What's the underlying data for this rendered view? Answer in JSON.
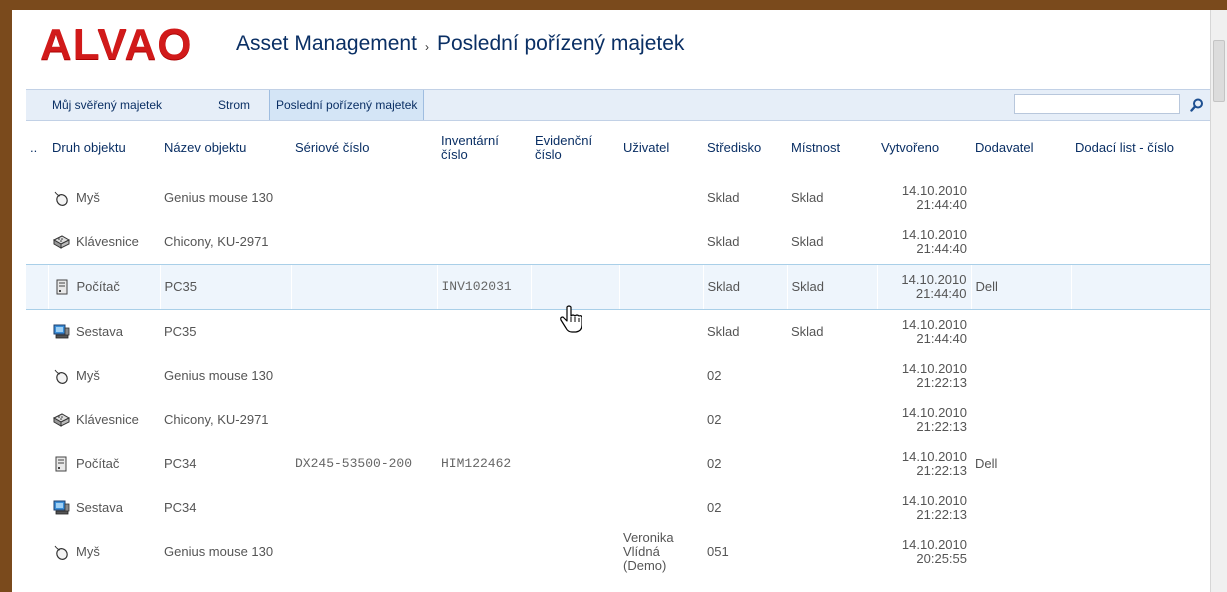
{
  "app": {
    "logo": "ALVAO",
    "breadcrumb": [
      "Asset Management",
      "Poslední pořízený majetek"
    ],
    "separator": "›"
  },
  "tabs": [
    {
      "label": "Můj svěřený majetek",
      "active": false
    },
    {
      "label": "Strom",
      "active": false
    },
    {
      "label": "Poslední pořízený majetek",
      "active": true
    }
  ],
  "search": {
    "value": "",
    "placeholder": ""
  },
  "table": {
    "columns": [
      "..",
      "Druh objektu",
      "Název objektu",
      "Sériové číslo",
      "Inventární číslo",
      "Evidenční číslo",
      "Uživatel",
      "Středisko",
      "Místnost",
      "Vytvořeno",
      "Dodavatel",
      "Dodací list - číslo"
    ],
    "rows": [
      {
        "icon": "mouse-icon",
        "druh": "Myš",
        "nazev": "Genius mouse 130",
        "seriove": "",
        "inventarni": "",
        "evidencni": "",
        "uzivatel": "",
        "stredisko": "Sklad",
        "mistnost": "Sklad",
        "vytvoreno_date": "14.10.2010",
        "vytvoreno_time": "21:44:40",
        "dodavatel": "",
        "dodaci": ""
      },
      {
        "icon": "keyboard-icon",
        "druh": "Klávesnice",
        "nazev": "Chicony, KU-2971",
        "seriove": "",
        "inventarni": "",
        "evidencni": "",
        "uzivatel": "",
        "stredisko": "Sklad",
        "mistnost": "Sklad",
        "vytvoreno_date": "14.10.2010",
        "vytvoreno_time": "21:44:40",
        "dodavatel": "",
        "dodaci": ""
      },
      {
        "icon": "computer-icon",
        "druh": "Počítač",
        "nazev": "PC35",
        "seriove": "",
        "inventarni": "INV102031",
        "evidencni": "",
        "uzivatel": "",
        "stredisko": "Sklad",
        "mistnost": "Sklad",
        "vytvoreno_date": "14.10.2010",
        "vytvoreno_time": "21:44:40",
        "dodavatel": "Dell",
        "dodaci": "",
        "highlighted": true
      },
      {
        "icon": "workstation-icon",
        "druh": "Sestava",
        "nazev": "PC35",
        "seriove": "",
        "inventarni": "",
        "evidencni": "",
        "uzivatel": "",
        "stredisko": "Sklad",
        "mistnost": "Sklad",
        "vytvoreno_date": "14.10.2010",
        "vytvoreno_time": "21:44:40",
        "dodavatel": "",
        "dodaci": ""
      },
      {
        "icon": "mouse-icon",
        "druh": "Myš",
        "nazev": "Genius mouse 130",
        "seriove": "",
        "inventarni": "",
        "evidencni": "",
        "uzivatel": "",
        "stredisko": "02",
        "mistnost": "",
        "vytvoreno_date": "14.10.2010",
        "vytvoreno_time": "21:22:13",
        "dodavatel": "",
        "dodaci": ""
      },
      {
        "icon": "keyboard-icon",
        "druh": "Klávesnice",
        "nazev": "Chicony, KU-2971",
        "seriove": "",
        "inventarni": "",
        "evidencni": "",
        "uzivatel": "",
        "stredisko": "02",
        "mistnost": "",
        "vytvoreno_date": "14.10.2010",
        "vytvoreno_time": "21:22:13",
        "dodavatel": "",
        "dodaci": ""
      },
      {
        "icon": "computer-icon",
        "druh": "Počítač",
        "nazev": "PC34",
        "seriove": "DX245-53500-200",
        "inventarni": "HIM122462",
        "evidencni": "",
        "uzivatel": "",
        "stredisko": "02",
        "mistnost": "",
        "vytvoreno_date": "14.10.2010",
        "vytvoreno_time": "21:22:13",
        "dodavatel": "Dell",
        "dodaci": ""
      },
      {
        "icon": "workstation-icon",
        "druh": "Sestava",
        "nazev": "PC34",
        "seriove": "",
        "inventarni": "",
        "evidencni": "",
        "uzivatel": "",
        "stredisko": "02",
        "mistnost": "",
        "vytvoreno_date": "14.10.2010",
        "vytvoreno_time": "21:22:13",
        "dodavatel": "",
        "dodaci": ""
      },
      {
        "icon": "mouse-icon",
        "druh": "Myš",
        "nazev": "Genius mouse 130",
        "seriove": "",
        "inventarni": "",
        "evidencni": "",
        "uzivatel": "Veronika Vlídná (Demo)",
        "stredisko": "051",
        "mistnost": "",
        "vytvoreno_date": "14.10.2010",
        "vytvoreno_time": "20:25:55",
        "dodavatel": "",
        "dodaci": ""
      }
    ]
  },
  "colors": {
    "brand": "#d11a1a",
    "link": "#0a2f64",
    "frame": "#7a4a1c",
    "highlight": "#eef5fc"
  }
}
